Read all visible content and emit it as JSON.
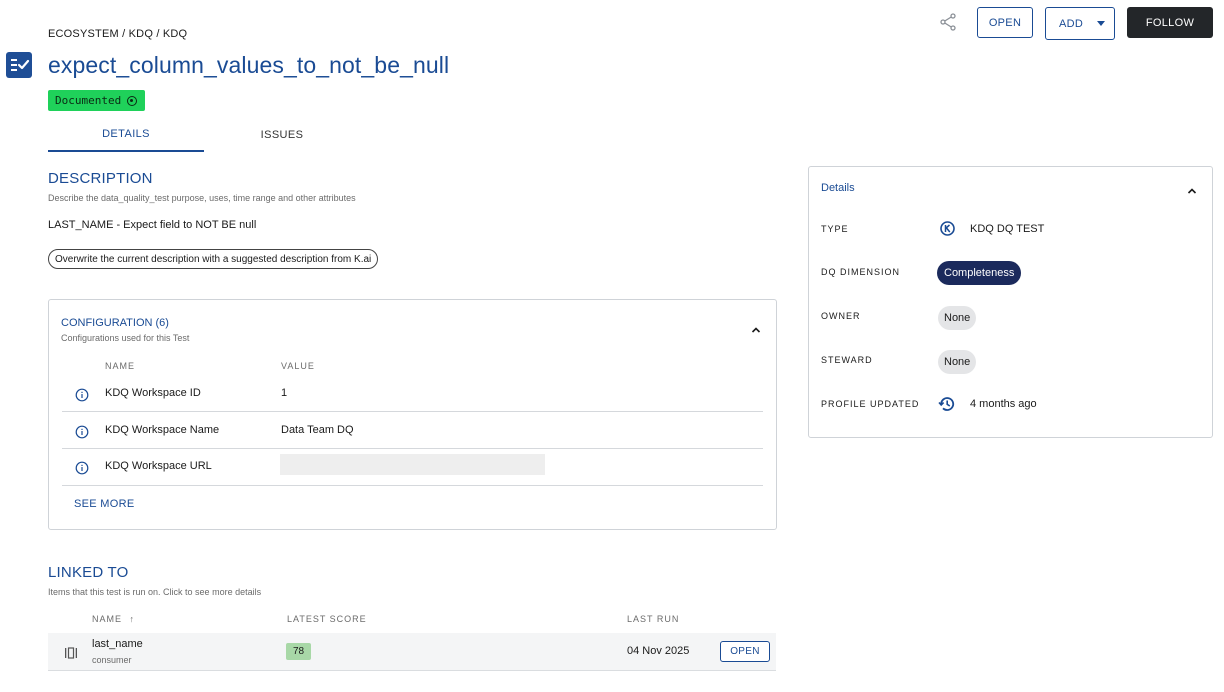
{
  "header": {
    "breadcrumb": "ECOSYSTEM / KDQ / KDQ",
    "title": "expect_column_values_to_not_be_null",
    "status_badge": "Documented"
  },
  "actions": {
    "open_label": "OPEN",
    "add_label": "ADD",
    "follow_label": "FOLLOW"
  },
  "tabs": [
    {
      "label": "DETAILS",
      "active": true
    },
    {
      "label": "ISSUES",
      "active": false
    }
  ],
  "description": {
    "heading": "DESCRIPTION",
    "subtitle": "Describe the data_quality_test purpose, uses, time range and other attributes",
    "text": "LAST_NAME - Expect field to NOT BE null",
    "suggest_button": "Overwrite the current description with a suggested description from K.ai"
  },
  "configuration": {
    "title": "CONFIGURATION (6)",
    "subtitle": "Configurations used for this Test",
    "columns": [
      "NAME",
      "VALUE"
    ],
    "rows": [
      {
        "name": "KDQ Workspace ID",
        "value": "1"
      },
      {
        "name": "KDQ Workspace Name",
        "value": "Data Team DQ"
      },
      {
        "name": "KDQ Workspace URL",
        "value": ""
      }
    ],
    "see_more": "SEE MORE"
  },
  "linked": {
    "heading": "LINKED TO",
    "subtitle": "Items that this test is run on. Click to see more details",
    "columns": {
      "name": "NAME",
      "sort_arrow": "↑",
      "score": "LATEST SCORE",
      "last_run": "LAST RUN"
    },
    "rows": [
      {
        "name": "last_name",
        "parent": "consumer",
        "score": "78",
        "last_run": "04 Nov 2025",
        "open_label": "OPEN"
      }
    ]
  },
  "details": {
    "title": "Details",
    "type_label": "TYPE",
    "type_value": "KDQ DQ TEST",
    "dq_dimension_label": "DQ DIMENSION",
    "dq_dimension_value": "Completeness",
    "owner_label": "OWNER",
    "owner_value": "None",
    "steward_label": "STEWARD",
    "steward_value": "None",
    "profile_updated_label": "PROFILE UPDATED",
    "profile_updated_value": "4 months ago"
  },
  "colors": {
    "primary": "#1a4b94",
    "documented_badge": "#1fd15a",
    "follow_button": "#232629",
    "completeness_pill": "#1b2a5c",
    "score_badge": "#a8d8a7"
  }
}
